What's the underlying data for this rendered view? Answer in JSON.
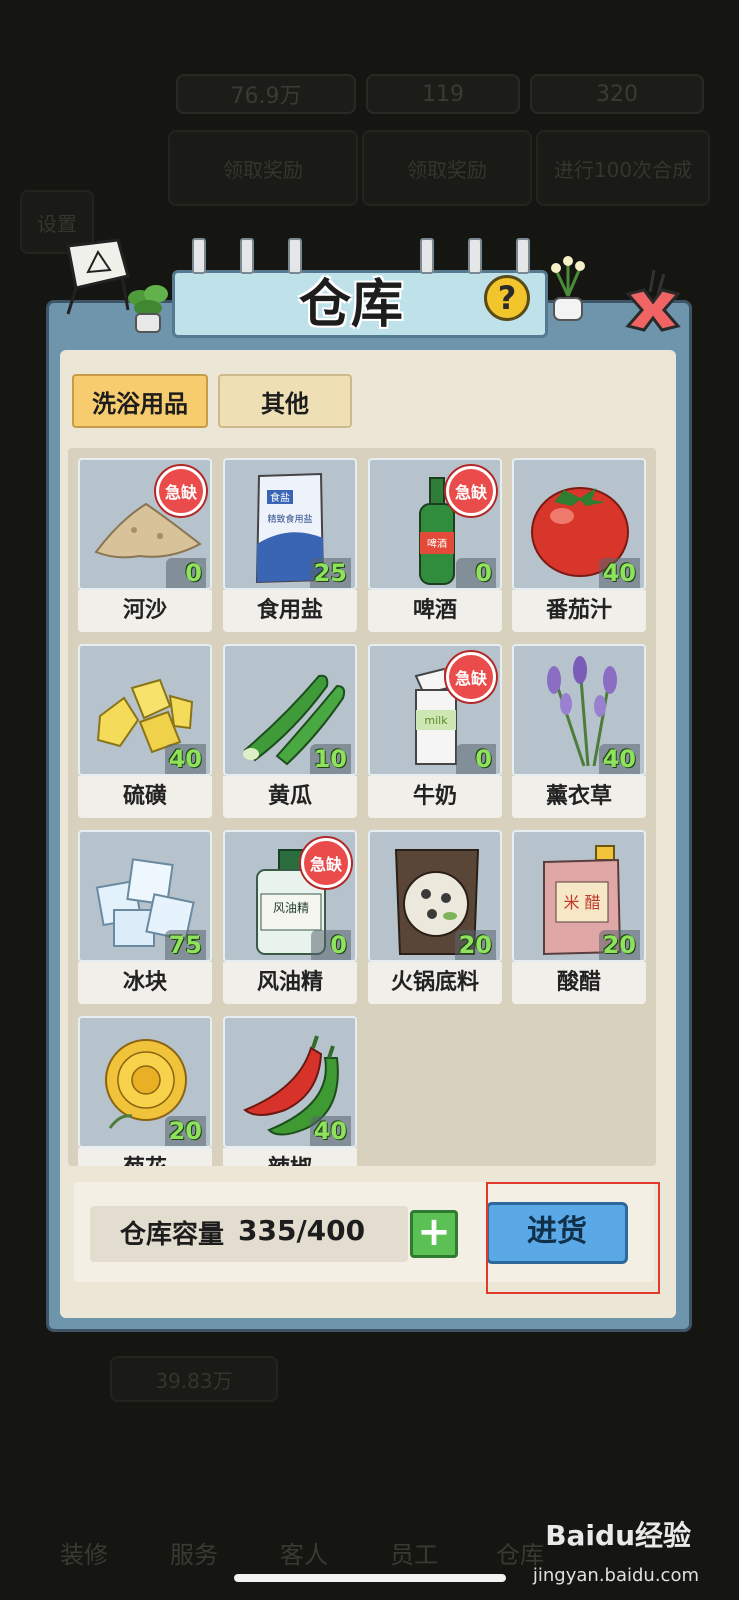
{
  "background": {
    "coins": "76.9万",
    "gems": "119",
    "energy": "320",
    "reward_1": "领取奖励",
    "reward_2": "领取奖励",
    "quest": "进行100次合成",
    "settings": "设置",
    "earnings": "39.83万",
    "tabs": [
      "装修",
      "服务",
      "客人",
      "员工",
      "仓库"
    ]
  },
  "dialog": {
    "title": "仓库",
    "help_label": "?",
    "tabs": [
      {
        "label": "洗浴用品",
        "active": true
      },
      {
        "label": "其他",
        "active": false
      }
    ],
    "items": [
      {
        "name": "河沙",
        "count": "0",
        "shortage": "急缺",
        "icon": "sand-icon"
      },
      {
        "name": "食用盐",
        "count": "25",
        "shortage": "",
        "icon": "salt-bag-icon",
        "bag_line1": "食盐",
        "bag_line2": "精致食用盐"
      },
      {
        "name": "啤酒",
        "count": "0",
        "shortage": "急缺",
        "icon": "beer-bottle-icon",
        "label": "啤酒"
      },
      {
        "name": "番茄汁",
        "count": "40",
        "shortage": "",
        "icon": "tomato-icon"
      },
      {
        "name": "硫磺",
        "count": "40",
        "shortage": "",
        "icon": "sulfur-icon"
      },
      {
        "name": "黄瓜",
        "count": "10",
        "shortage": "",
        "icon": "cucumber-icon"
      },
      {
        "name": "牛奶",
        "count": "0",
        "shortage": "急缺",
        "icon": "milk-carton-icon",
        "label": "milk"
      },
      {
        "name": "薰衣草",
        "count": "40",
        "shortage": "",
        "icon": "lavender-icon"
      },
      {
        "name": "冰块",
        "count": "75",
        "shortage": "",
        "icon": "ice-cube-icon"
      },
      {
        "name": "风油精",
        "count": "0",
        "shortage": "急缺",
        "icon": "oil-bottle-icon",
        "label": "风油精"
      },
      {
        "name": "火锅底料",
        "count": "20",
        "shortage": "",
        "icon": "hotpot-base-icon"
      },
      {
        "name": "酸醋",
        "count": "20",
        "shortage": "",
        "icon": "vinegar-jug-icon",
        "label": "米 醋"
      },
      {
        "name": "菊花",
        "count": "20",
        "shortage": "",
        "icon": "chrysanthemum-icon"
      },
      {
        "name": "辣椒",
        "count": "40",
        "shortage": "",
        "icon": "chili-icon"
      }
    ],
    "capacity_label": "仓库容量",
    "capacity_value": "335/400",
    "expand_label": "+",
    "restock_label": "进货"
  },
  "watermark": {
    "brand": "Baidu经验",
    "url": "jingyan.baidu.com"
  },
  "colors": {
    "active_tab": "#f6cc6f",
    "shortage_stamp": "#ea4b4b",
    "count_text": "#8fe25e",
    "restock_button": "#5aa8e6",
    "highlight_box": "#e23a2a"
  }
}
